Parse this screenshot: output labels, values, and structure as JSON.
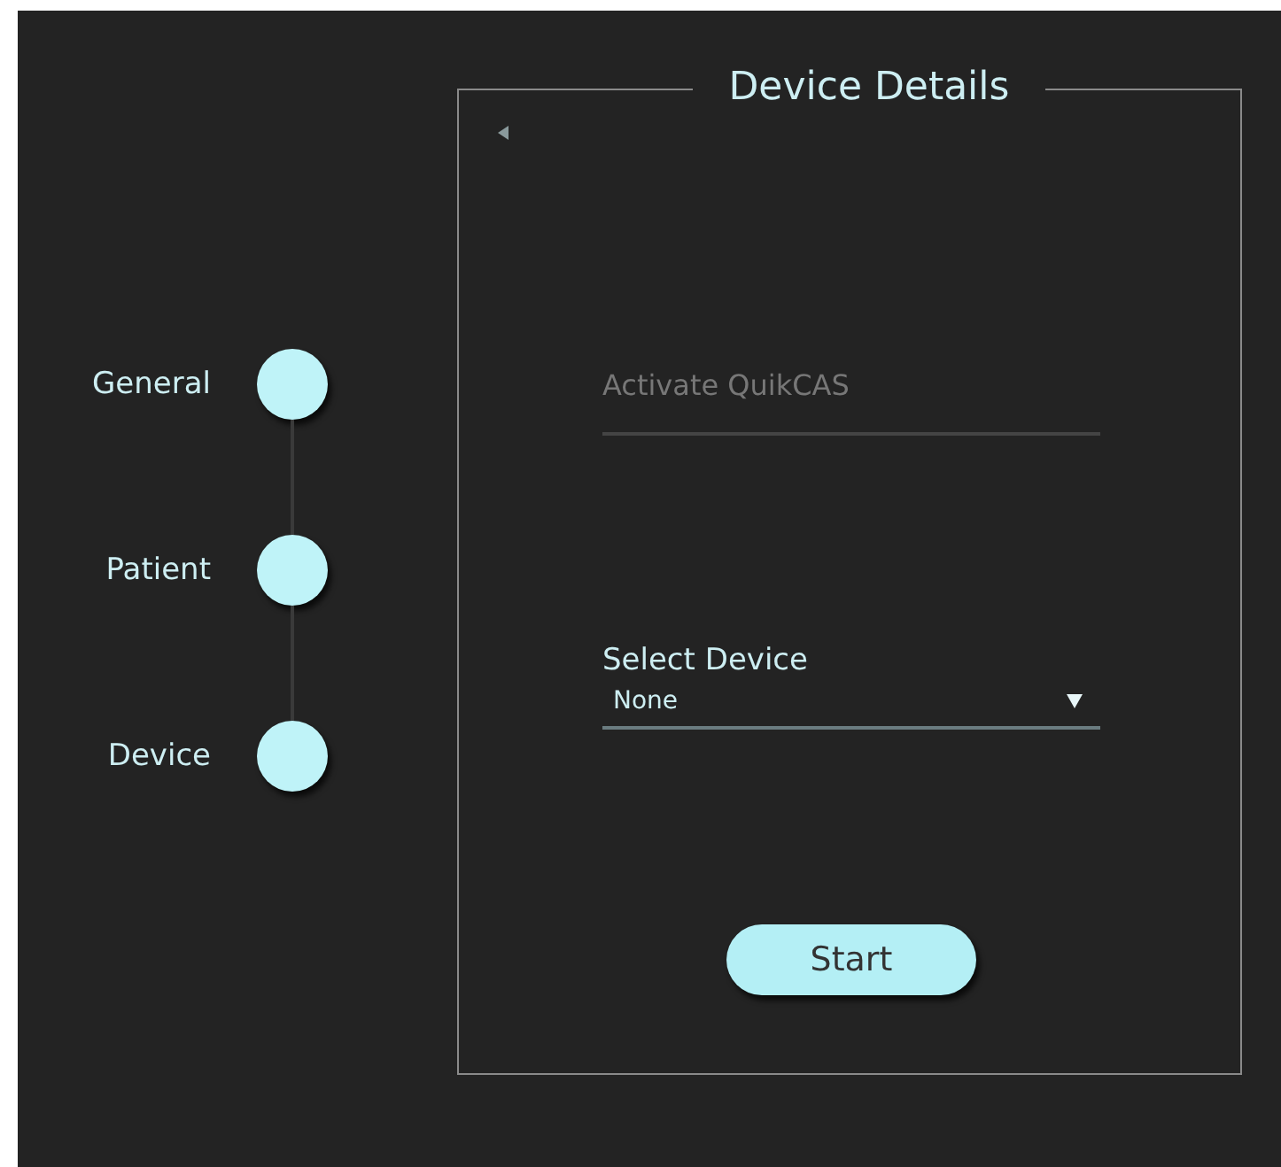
{
  "steps": [
    {
      "label": "General"
    },
    {
      "label": "Patient"
    },
    {
      "label": "Device"
    }
  ],
  "panel": {
    "title": "Device Details",
    "activation_field": {
      "placeholder": "Activate QuikCAS"
    },
    "device_select": {
      "label": "Select Device",
      "value": "None"
    },
    "start_button": "Start"
  }
}
